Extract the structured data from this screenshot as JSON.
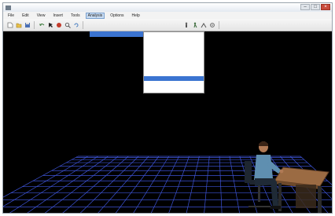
{
  "app": {
    "title": "",
    "window_controls": {
      "minimize": "–",
      "maximize": "□",
      "close": "×"
    }
  },
  "menubar": {
    "items": [
      {
        "label": "File"
      },
      {
        "label": "Edit"
      },
      {
        "label": "View"
      },
      {
        "label": "Insert"
      },
      {
        "label": "Tools"
      },
      {
        "label": "Analysis"
      },
      {
        "label": "Options"
      },
      {
        "label": "Help"
      }
    ]
  },
  "toolbar": {
    "buttons": [
      "new-icon",
      "open-icon",
      "save-icon",
      "undo-icon",
      "select-icon",
      "pan-icon",
      "zoom-icon",
      "rotate-icon",
      "human-icon",
      "walk-icon",
      "lift-icon",
      "settings-icon"
    ]
  },
  "submenu_strip": {
    "label": ""
  },
  "dropdown": {
    "items": [
      {
        "label": ""
      },
      {
        "label": ""
      },
      {
        "label": ""
      },
      {
        "label": ""
      },
      {
        "label": ""
      },
      {
        "label": ""
      },
      {
        "label": ""
      },
      {
        "label": ""
      },
      {
        "label": "",
        "selected": true
      },
      {
        "label": ""
      },
      {
        "label": ""
      },
      {
        "label": ""
      },
      {
        "label": ""
      }
    ]
  },
  "colors": {
    "grid_line": "#3d53d6",
    "highlight": "#3b74d1",
    "background": "#000000"
  }
}
